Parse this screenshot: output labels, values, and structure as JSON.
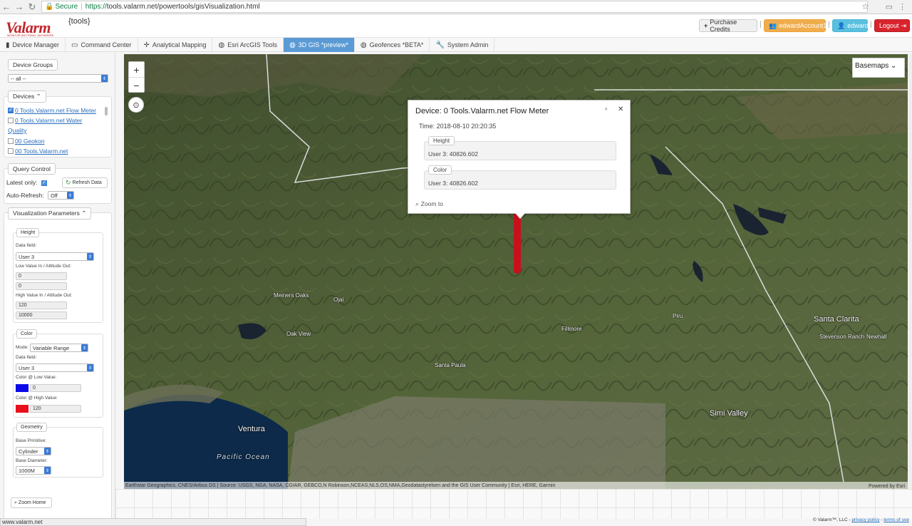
{
  "browser": {
    "secure_label": "Secure",
    "url_scheme": "https://",
    "url_rest": "tools.valarm.net/powertools/gisVisualization.html"
  },
  "header": {
    "logo": "Valarm",
    "logo_tagline": "MONITOR ANYTHING, ANYWHERE",
    "logo_suffix": "{tools}",
    "purchase_credits": "Purchase Credits",
    "account": "edwardAccount1",
    "user": "edward",
    "logout": "Logout"
  },
  "tabs": [
    {
      "label": "Device Manager",
      "icon": "signal-icon",
      "active": false
    },
    {
      "label": "Command Center",
      "icon": "monitor-icon",
      "active": false
    },
    {
      "label": "Analytical Mapping",
      "icon": "crosshair-icon",
      "active": false
    },
    {
      "label": "Esri ArcGIS Tools",
      "icon": "globe-icon",
      "active": false
    },
    {
      "label": "3D GIS *preview*",
      "icon": "globe-icon",
      "active": true
    },
    {
      "label": "Geofences *BETA*",
      "icon": "globe-icon",
      "active": false
    },
    {
      "label": "System Admin",
      "icon": "wrench-icon",
      "active": false
    }
  ],
  "sidebar": {
    "device_groups": {
      "legend": "Device Groups",
      "selected": "-- all --"
    },
    "devices": {
      "legend": "Devices",
      "items": [
        {
          "label": "0 Tools.Valarm.net Flow Meter",
          "checked": true
        },
        {
          "label": "0 Tools.Valarm.net Water",
          "checked": false
        },
        {
          "label": "Quality",
          "checked": false
        },
        {
          "label": "00 Geokon",
          "checked": false
        },
        {
          "label": "00 Tools.Valarm.net",
          "checked": false
        }
      ]
    },
    "query": {
      "legend": "Query Control",
      "latest_only": "Latest only:",
      "refresh": "Refresh Data",
      "auto_refresh": "Auto-Refresh:",
      "auto_refresh_value": "Off"
    },
    "viz": {
      "legend": "Visualization Parameters",
      "height": {
        "legend": "Height",
        "data_field_label": "Data field:",
        "data_field_value": "User 3",
        "low_label": "Low Value In / Altitude Out:",
        "low_in": "0",
        "low_out": "0",
        "high_label": "High Value In / Altitude Out:",
        "high_in": "120",
        "high_out": "10000"
      },
      "color": {
        "legend": "Color",
        "mode_label": "Mode:",
        "mode_value": "Variable Range",
        "data_field_label": "Data field:",
        "data_field_value": "User 3",
        "low_label": "Color @ Low Value:",
        "low_value": "0",
        "low_color": "#0a0ae8",
        "high_label": "Color @ High Value:",
        "high_value": "120",
        "high_color": "#e8101d"
      },
      "geometry": {
        "legend": "Geometry",
        "primitive_label": "Base Primitive:",
        "primitive_value": "Cylinder",
        "diameter_label": "Base Diameter:",
        "diameter_value": "1000M"
      }
    },
    "zoom_home": "Zoom Home"
  },
  "map": {
    "basemaps": "Basemaps",
    "places": [
      {
        "name": "Meiners Oaks",
        "cls": ""
      },
      {
        "name": "Ojai",
        "cls": ""
      },
      {
        "name": "Oak View",
        "cls": ""
      },
      {
        "name": "Santa Paula",
        "cls": ""
      },
      {
        "name": "Fillmore",
        "cls": ""
      },
      {
        "name": "Piru",
        "cls": ""
      },
      {
        "name": "Santa Clarita",
        "cls": "big"
      },
      {
        "name": "Stevenson Ranch",
        "cls": ""
      },
      {
        "name": "Newhall",
        "cls": ""
      },
      {
        "name": "Simi Valley",
        "cls": "big"
      },
      {
        "name": "Ventura",
        "cls": "big"
      },
      {
        "name": "Pacific Ocean",
        "cls": "water"
      }
    ],
    "attribution": "Earthstar Geographics, CNES/Airbus DS | Source: USGS, NGA, NASA, CGIAR, GEBCO,N Robinson,NCEAS,NLS,OS,NMA,Geodatastyrelsen and the GIS User Community | Esri, HERE, Garmin",
    "powered_by": "Powered by Esri"
  },
  "popup": {
    "title": "Device: 0 Tools.Valarm.net Flow Meter",
    "time": "Time: 2018-08-10 20:20:35",
    "height_legend": "Height",
    "height_value": "User 3: 40826.602",
    "color_legend": "Color",
    "color_value": "User 3: 40826.602",
    "zoom_to": "Zoom to"
  },
  "status_url": "www.valarm.net",
  "footer": {
    "copyright": "© Valarm™, LLC -",
    "privacy": "privacy policy",
    "terms": "terms of use"
  }
}
